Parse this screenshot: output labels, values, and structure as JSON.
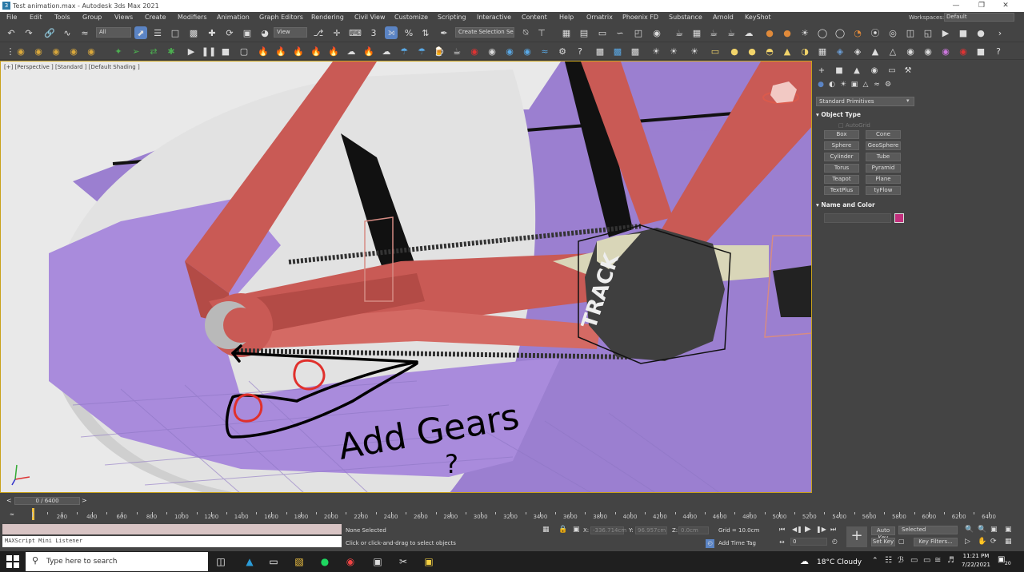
{
  "window": {
    "title": "Test animation.max - Autodesk 3ds Max 2021",
    "app_icon": "3"
  },
  "menu": [
    "File",
    "Edit",
    "Tools",
    "Group",
    "Views",
    "Create",
    "Modifiers",
    "Animation",
    "Graph Editors",
    "Rendering",
    "Civil View",
    "Customize",
    "Scripting",
    "Interactive",
    "Content",
    "Help",
    "Ornatrix",
    "Phoenix FD",
    "Substance",
    "Arnold",
    "KeyShot"
  ],
  "workspaces": {
    "label": "Workspaces:",
    "value": "Default"
  },
  "toolbar": {
    "filter_select": "All",
    "ref_coord_select": "View",
    "selection_set": "Create Selection Se"
  },
  "viewport": {
    "label": "[+] [Perspective ] [Standard ] [Default Shading ]",
    "hub_text": "TRACK",
    "annotation_text_1": "Add Gears",
    "annotation_text_2": "?"
  },
  "command_panel": {
    "category_select": "Standard Primitives",
    "object_type_header": "Object Type",
    "autogrid": "AutoGrid",
    "primitives": [
      "Box",
      "Cone",
      "Sphere",
      "GeoSphere",
      "Cylinder",
      "Tube",
      "Torus",
      "Pyramid",
      "Teapot",
      "Plane",
      "TextPlus",
      "tyFlow"
    ],
    "name_color_header": "Name and Color",
    "object_color": "#c2307d"
  },
  "timeline": {
    "time_slider": "0 / 6400",
    "ticks": [
      "200",
      "400",
      "600",
      "800",
      "1000",
      "1200",
      "1400",
      "1600",
      "1800",
      "2000",
      "2200",
      "2400",
      "2600",
      "2800",
      "3000",
      "3200",
      "3400",
      "3600",
      "3800",
      "4000",
      "4200",
      "4400",
      "4600",
      "4800",
      "5000",
      "5200",
      "5400",
      "5600",
      "5800",
      "6000",
      "6200",
      "6400"
    ]
  },
  "status": {
    "maxscript": "MAXScript Mini Listener",
    "selection": "None Selected",
    "prompt": "Click or click-and-drag to select objects",
    "x_label": "X:",
    "x_value": "-336.714cm",
    "y_label": "Y:",
    "y_value": "96.957cm",
    "z_label": "Z:",
    "z_value": "0.0cm",
    "grid": "Grid = 10.0cm",
    "add_time_tag": "Add Time Tag",
    "frame_value": "0",
    "auto_key": "Auto Key",
    "set_key": "Set Key",
    "selected_select": "Selected",
    "key_filters": "Key Filters..."
  },
  "taskbar": {
    "search_placeholder": "Type here to search",
    "weather": "18°C  Cloudy",
    "time": "11:21 PM",
    "date": "7/22/2021",
    "notifications": "20"
  },
  "colors": {
    "frame_red": "#c95a55",
    "floor_purple": "#9b7fd0",
    "selected_tool": "#5b84c4",
    "viewport_border": "#c9a21b"
  }
}
